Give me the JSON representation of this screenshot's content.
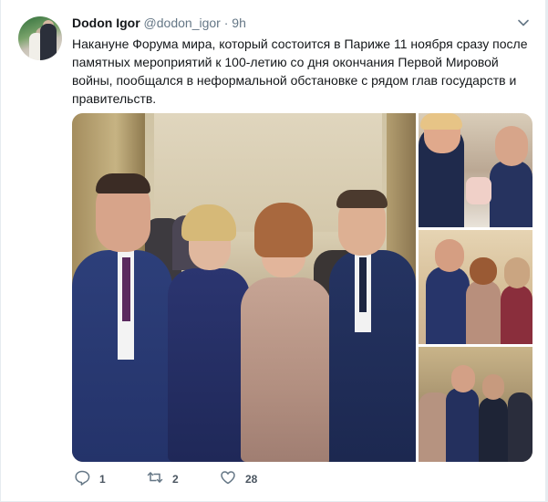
{
  "tweet": {
    "author_name": "Dodon Igor",
    "author_handle": "@dodon_igor",
    "separator": "·",
    "time": "9h",
    "text": "Накануне Форума мира, который состоится в Париже 11 ноября сразу после памятных мероприятий к 100-летию со дня окончания Первой Мировой войны, пообщался в неформальной обстановке с рядом глав государств и правительств.",
    "replies": "1",
    "retweets": "2",
    "likes": "28"
  },
  "icons": {
    "more": "chevron-down-icon",
    "reply": "reply-icon",
    "retweet": "retweet-icon",
    "like": "heart-icon"
  },
  "colors": {
    "text": "#14171a",
    "muted": "#657786",
    "background": "#e6ecf0",
    "card": "#ffffff"
  }
}
